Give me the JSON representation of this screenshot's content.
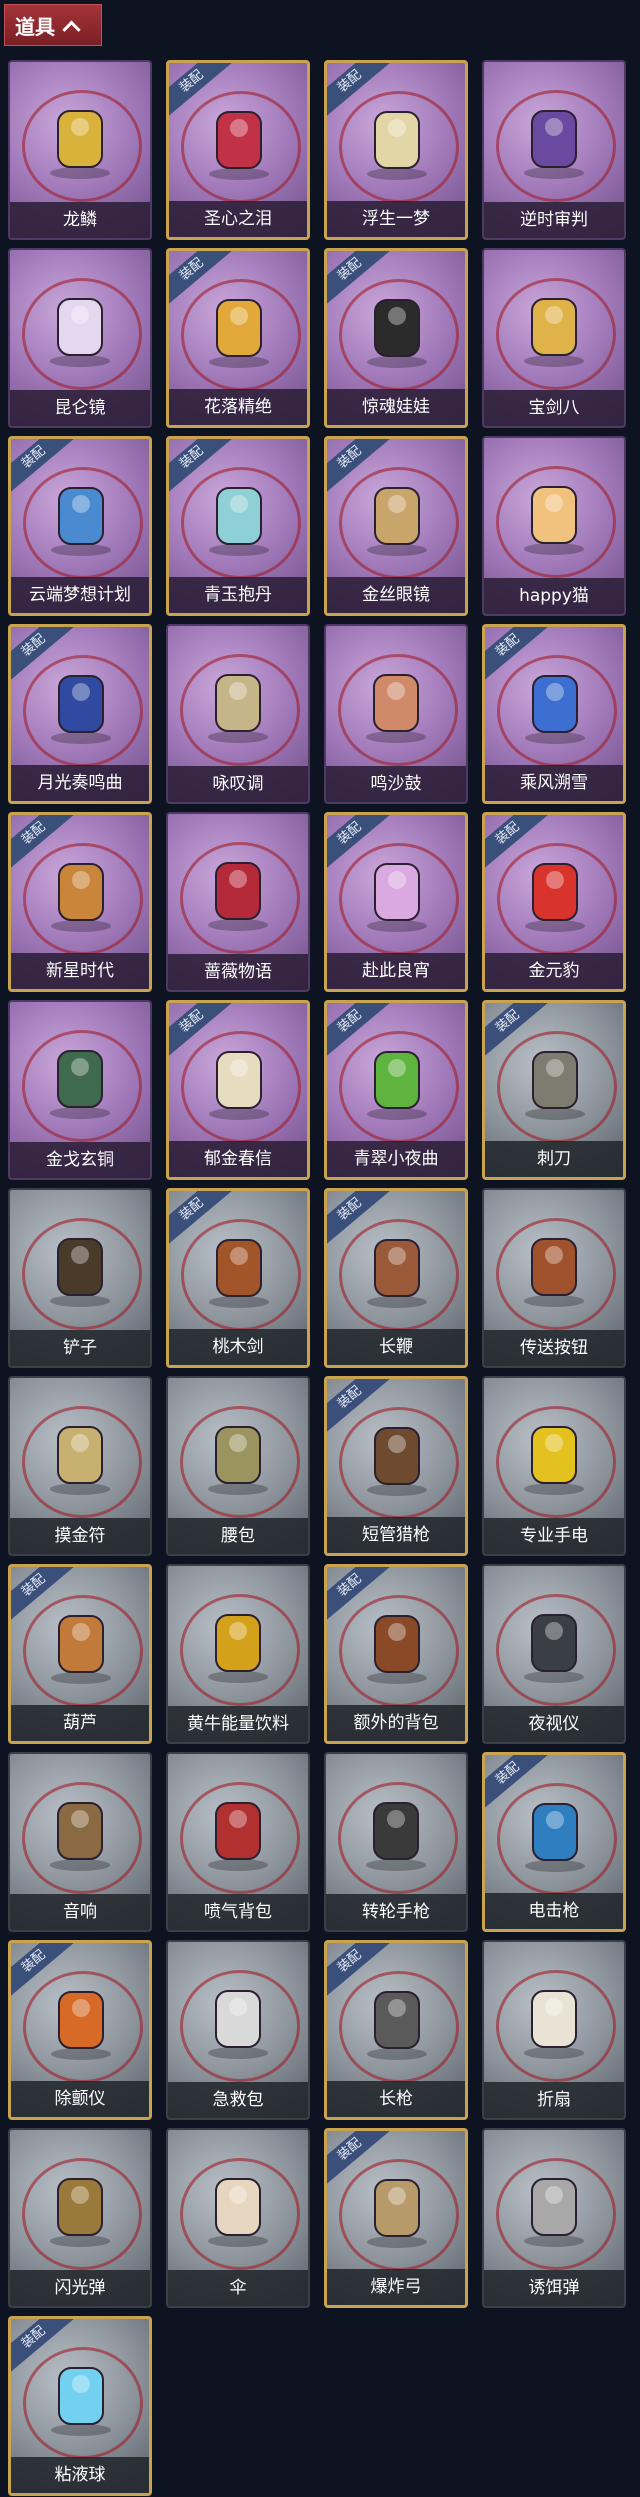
{
  "header": {
    "title": "道具"
  },
  "badge_text": "装配",
  "items": [
    {
      "name": "龙鳞",
      "style": "purple",
      "equipped": false,
      "icon": "golden-key-icon",
      "accent": "#d9b23c"
    },
    {
      "name": "圣心之泪",
      "style": "purple",
      "equipped": true,
      "icon": "ruby-scepter-icon",
      "accent": "#c23247"
    },
    {
      "name": "浮生一梦",
      "style": "purple",
      "equipped": true,
      "icon": "scroll-icon",
      "accent": "#e2d6a6"
    },
    {
      "name": "逆时审判",
      "style": "purple",
      "equipped": false,
      "icon": "pocket-watch-icon",
      "accent": "#6a4aa0"
    },
    {
      "name": "昆仑镜",
      "style": "purple",
      "equipped": false,
      "icon": "mirror-icon",
      "accent": "#e6d7f0"
    },
    {
      "name": "花落精绝",
      "style": "purple",
      "equipped": true,
      "icon": "flower-necklace-icon",
      "accent": "#e2a93a"
    },
    {
      "name": "惊魂娃娃",
      "style": "purple",
      "equipped": true,
      "icon": "doll-icon",
      "accent": "#2b2b2b"
    },
    {
      "name": "宝剑八",
      "style": "purple",
      "equipped": false,
      "icon": "heart-icon",
      "accent": "#e0b34a"
    },
    {
      "name": "云端梦想计划",
      "style": "purple",
      "equipped": true,
      "icon": "cosmic-wand-icon",
      "accent": "#4a8ad0"
    },
    {
      "name": "青玉抱丹",
      "style": "purple",
      "equipped": true,
      "icon": "jade-bottle-icon",
      "accent": "#8fd0d6"
    },
    {
      "name": "金丝眼镜",
      "style": "purple",
      "equipped": true,
      "icon": "glasses-icon",
      "accent": "#c8a56a"
    },
    {
      "name": "happy猫",
      "style": "purple",
      "equipped": false,
      "icon": "cat-icon",
      "accent": "#f1c27d"
    },
    {
      "name": "月光奏鸣曲",
      "style": "purple",
      "equipped": true,
      "icon": "piano-icon",
      "accent": "#2f4aa0"
    },
    {
      "name": "咏叹调",
      "style": "purple",
      "equipped": false,
      "icon": "birdcage-icon",
      "accent": "#c7b58a"
    },
    {
      "name": "鸣沙鼓",
      "style": "purple",
      "equipped": false,
      "icon": "drum-icon",
      "accent": "#d08a6a"
    },
    {
      "name": "乘风溯雪",
      "style": "purple",
      "equipped": true,
      "icon": "snow-device-icon",
      "accent": "#3d6fd0"
    },
    {
      "name": "新星时代",
      "style": "purple",
      "equipped": true,
      "icon": "revolver-icon",
      "accent": "#c9863a"
    },
    {
      "name": "蔷薇物语",
      "style": "purple",
      "equipped": false,
      "icon": "medkit-icon",
      "accent": "#b52a3a"
    },
    {
      "name": "赴此良宵",
      "style": "purple",
      "equipped": true,
      "icon": "fan-icon",
      "accent": "#d9a9e0"
    },
    {
      "name": "金元豹",
      "style": "purple",
      "equipped": true,
      "icon": "mascot-icon",
      "accent": "#d9332e"
    },
    {
      "name": "金戈玄铜",
      "style": "purple",
      "equipped": false,
      "icon": "grenade-icon",
      "accent": "#3f6a4d"
    },
    {
      "name": "郁金春信",
      "style": "purple",
      "equipped": true,
      "icon": "umbrella-icon",
      "accent": "#e8dcc0"
    },
    {
      "name": "青翠小夜曲",
      "style": "purple",
      "equipped": true,
      "icon": "frog-icon",
      "accent": "#5fb33f"
    },
    {
      "name": "刺刀",
      "style": "gray",
      "equipped": true,
      "icon": "bayonet-icon",
      "accent": "#7c7c70"
    },
    {
      "name": "铲子",
      "style": "gray",
      "equipped": false,
      "icon": "shovel-icon",
      "accent": "#4a3a2a"
    },
    {
      "name": "桃木剑",
      "style": "gray",
      "equipped": true,
      "icon": "wooden-sword-icon",
      "accent": "#a3552a"
    },
    {
      "name": "长鞭",
      "style": "gray",
      "equipped": true,
      "icon": "whip-icon",
      "accent": "#9a5a3a"
    },
    {
      "name": "传送按钮",
      "style": "gray",
      "equipped": false,
      "icon": "remote-icon",
      "accent": "#a0522d"
    },
    {
      "name": "摸金符",
      "style": "gray",
      "equipped": false,
      "icon": "talisman-icon",
      "accent": "#c8b070"
    },
    {
      "name": "腰包",
      "style": "gray",
      "equipped": false,
      "icon": "bag-icon",
      "accent": "#9b9460"
    },
    {
      "name": "短管猎枪",
      "style": "gray",
      "equipped": true,
      "icon": "shotgun-icon",
      "accent": "#6e4a2e"
    },
    {
      "name": "专业手电",
      "style": "gray",
      "equipped": false,
      "icon": "flashlight-icon",
      "accent": "#e3c21f"
    },
    {
      "name": "葫芦",
      "style": "gray",
      "equipped": true,
      "icon": "gourd-icon",
      "accent": "#c27a3a"
    },
    {
      "name": "黄牛能量饮料",
      "style": "gray",
      "equipped": false,
      "icon": "can-icon",
      "accent": "#d4a21a"
    },
    {
      "name": "额外的背包",
      "style": "gray",
      "equipped": true,
      "icon": "backpack-icon",
      "accent": "#8a4a28"
    },
    {
      "name": "夜视仪",
      "style": "gray",
      "equipped": false,
      "icon": "goggles-icon",
      "accent": "#3a3f46"
    },
    {
      "name": "音响",
      "style": "gray",
      "equipped": false,
      "icon": "boombox-icon",
      "accent": "#8a6a42"
    },
    {
      "name": "喷气背包",
      "style": "gray",
      "equipped": false,
      "icon": "jetpack-icon",
      "accent": "#b23030"
    },
    {
      "name": "转轮手枪",
      "style": "gray",
      "equipped": false,
      "icon": "pistol-icon",
      "accent": "#3a3a3a"
    },
    {
      "name": "电击枪",
      "style": "gray",
      "equipped": true,
      "icon": "taser-icon",
      "accent": "#2f7fc0"
    },
    {
      "name": "除颤仪",
      "style": "gray",
      "equipped": true,
      "icon": "defibrillator-icon",
      "accent": "#d86a28"
    },
    {
      "name": "急救包",
      "style": "gray",
      "equipped": false,
      "icon": "firstaid-icon",
      "accent": "#d9d9d9"
    },
    {
      "name": "长枪",
      "style": "gray",
      "equipped": true,
      "icon": "spear-icon",
      "accent": "#5a5a5a"
    },
    {
      "name": "折扇",
      "style": "gray",
      "equipped": false,
      "icon": "folding-fan-icon",
      "accent": "#e9e3d5"
    },
    {
      "name": "闪光弹",
      "style": "gray",
      "equipped": false,
      "icon": "flashbang-icon",
      "accent": "#9a7a3a"
    },
    {
      "name": "伞",
      "style": "gray",
      "equipped": false,
      "icon": "parasol-icon",
      "accent": "#e6d5bf"
    },
    {
      "name": "爆炸弓",
      "style": "gray",
      "equipped": true,
      "icon": "bow-icon",
      "accent": "#b79a6a"
    },
    {
      "name": "诱饵弹",
      "style": "gray",
      "equipped": false,
      "icon": "decoy-canister-icon",
      "accent": "#a8a8a8"
    },
    {
      "name": "粘液球",
      "style": "gray",
      "equipped": true,
      "icon": "slime-flask-icon",
      "accent": "#72d0f0"
    }
  ]
}
